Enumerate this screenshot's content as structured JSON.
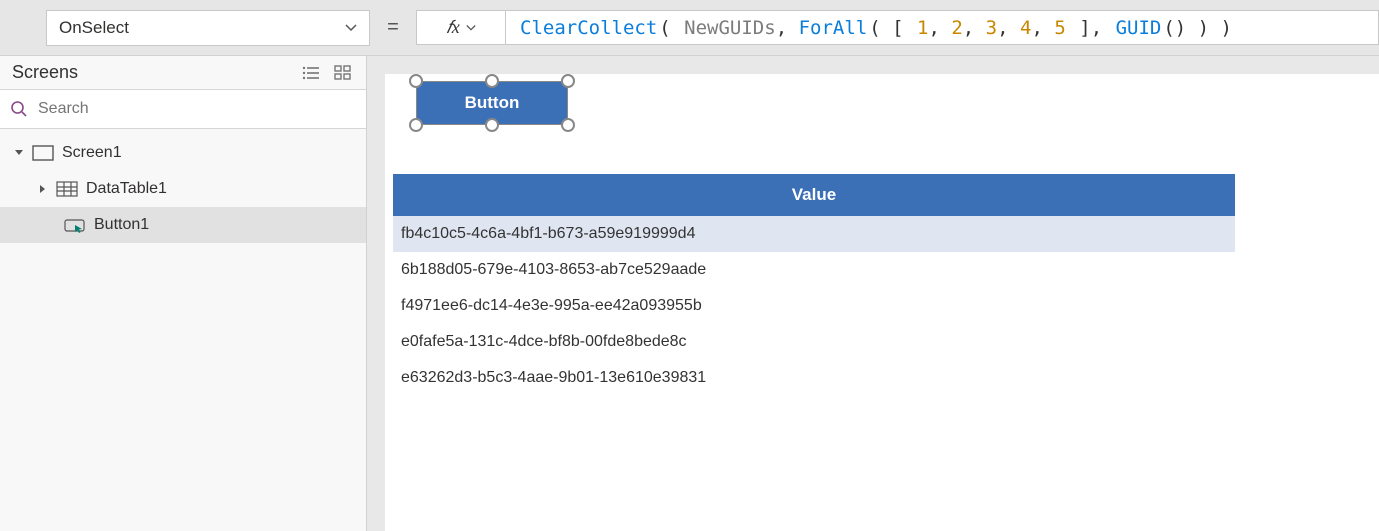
{
  "propertyDropdown": {
    "value": "OnSelect"
  },
  "formula": {
    "tokens": [
      {
        "t": "ClearCollect",
        "c": "func"
      },
      {
        "t": "( ",
        "c": "punct"
      },
      {
        "t": "NewGUIDs",
        "c": "var"
      },
      {
        "t": ", ",
        "c": "sep"
      },
      {
        "t": "ForAll",
        "c": "func"
      },
      {
        "t": "( [ ",
        "c": "punct"
      },
      {
        "t": "1",
        "c": "num"
      },
      {
        "t": ", ",
        "c": "sep"
      },
      {
        "t": "2",
        "c": "num"
      },
      {
        "t": ", ",
        "c": "sep"
      },
      {
        "t": "3",
        "c": "num"
      },
      {
        "t": ", ",
        "c": "sep"
      },
      {
        "t": "4",
        "c": "num"
      },
      {
        "t": ", ",
        "c": "sep"
      },
      {
        "t": "5",
        "c": "num"
      },
      {
        "t": " ], ",
        "c": "punct"
      },
      {
        "t": "GUID",
        "c": "func"
      },
      {
        "t": "() ) )",
        "c": "punct"
      }
    ]
  },
  "leftPanel": {
    "title": "Screens",
    "searchPlaceholder": "Search",
    "tree": {
      "screen": "Screen1",
      "children": [
        {
          "name": "DataTable1",
          "icon": "table",
          "selected": false
        },
        {
          "name": "Button1",
          "icon": "button",
          "selected": true
        }
      ]
    }
  },
  "canvas": {
    "buttonLabel": "Button",
    "datatable": {
      "header": "Value",
      "rows": [
        "fb4c10c5-4c6a-4bf1-b673-a59e919999d4",
        "6b188d05-679e-4103-8653-ab7ce529aade",
        "f4971ee6-dc14-4e3e-995a-ee42a093955b",
        "e0fafe5a-131c-4dce-bf8b-00fde8bede8c",
        "e63262d3-b5c3-4aae-9b01-13e610e39831"
      ]
    }
  },
  "colors": {
    "accent": "#3b6fb6"
  }
}
